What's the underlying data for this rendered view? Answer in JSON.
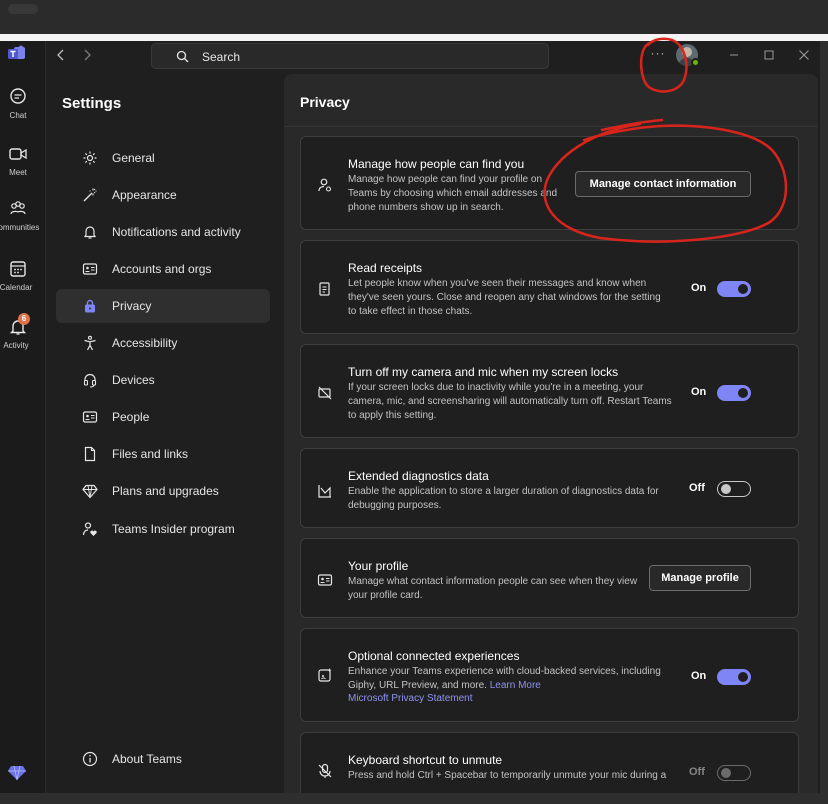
{
  "app": {
    "search_placeholder": "Search",
    "more_label": "···"
  },
  "rail": [
    {
      "label": "Chat",
      "icon": "chat-icon"
    },
    {
      "label": "Meet",
      "icon": "camera-icon"
    },
    {
      "label": "Communities",
      "icon": "communities-icon"
    },
    {
      "label": "Calendar",
      "icon": "calendar-icon"
    },
    {
      "label": "Activity",
      "icon": "bell-icon",
      "badge": "6"
    }
  ],
  "settings": {
    "title": "Settings",
    "items": [
      {
        "label": "General",
        "icon": "gear-icon"
      },
      {
        "label": "Appearance",
        "icon": "wand-icon"
      },
      {
        "label": "Notifications and activity",
        "icon": "bell-icon"
      },
      {
        "label": "Accounts and orgs",
        "icon": "id-card-icon"
      },
      {
        "label": "Privacy",
        "icon": "lock-icon",
        "active": true
      },
      {
        "label": "Accessibility",
        "icon": "accessibility-icon"
      },
      {
        "label": "Devices",
        "icon": "headset-icon"
      },
      {
        "label": "People",
        "icon": "contact-card-icon"
      },
      {
        "label": "Files and links",
        "icon": "document-icon"
      },
      {
        "label": "Plans and upgrades",
        "icon": "diamond-icon"
      },
      {
        "label": "Teams Insider program",
        "icon": "person-heart-icon"
      }
    ],
    "about": "About Teams"
  },
  "privacy": {
    "title": "Privacy",
    "find_you": {
      "title": "Manage how people can find you",
      "desc": "Manage how people can find your profile on Teams by choosing which email addresses and phone numbers show up in search.",
      "button": "Manage contact information"
    },
    "read_receipts": {
      "title": "Read receipts",
      "desc": "Let people know when you've seen their messages and know when they've seen yours. Close and reopen any chat windows for the setting to take effect in those chats.",
      "state": "On"
    },
    "camera_mic": {
      "title": "Turn off my camera and mic when my screen locks",
      "desc": "If your screen locks due to inactivity while you're in a meeting, your camera, mic, and screensharing will automatically turn off. Restart Teams to apply this setting.",
      "state": "On"
    },
    "diagnostics": {
      "title": "Extended diagnostics data",
      "desc": "Enable the application to store a larger duration of diagnostics data for debugging purposes.",
      "state": "Off"
    },
    "profile": {
      "title": "Your profile",
      "desc": "Manage what contact information people can see when they view your profile card.",
      "button": "Manage profile"
    },
    "connected": {
      "title": "Optional connected experiences",
      "desc": "Enhance your Teams experience with cloud-backed services, including Giphy, URL Preview, and more.",
      "learn_more": "Learn More",
      "privacy_link": "Microsoft Privacy Statement",
      "state": "On"
    },
    "unmute": {
      "title": "Keyboard shortcut to unmute",
      "desc": "Press and hold Ctrl + Spacebar to temporarily unmute your mic during a",
      "state": "Off"
    }
  },
  "colors": {
    "accent": "#7f85f5",
    "annotation": "#d9241c",
    "badge": "#e07148",
    "presence": "#6bb700"
  }
}
